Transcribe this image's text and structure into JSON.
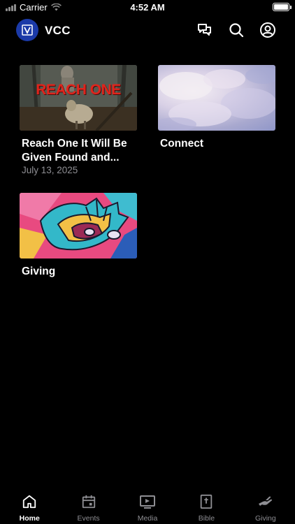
{
  "status_bar": {
    "carrier": "Carrier",
    "time": "4:52 AM",
    "battery_level": 1.0
  },
  "header": {
    "app_title": "VCC",
    "icons": [
      "chat-icon",
      "search-icon",
      "profile-icon"
    ]
  },
  "cards": [
    {
      "title": "Reach One It Will Be Given Found and...",
      "date": "July 13, 2025",
      "thumb_text": "REACH ONE"
    },
    {
      "title": "Connect"
    },
    {
      "title": "Giving"
    }
  ],
  "tabs": [
    {
      "label": "Home",
      "icon": "home-icon",
      "active": true
    },
    {
      "label": "Events",
      "icon": "calendar-icon",
      "active": false
    },
    {
      "label": "Media",
      "icon": "media-icon",
      "active": false
    },
    {
      "label": "Bible",
      "icon": "bible-icon",
      "active": false
    },
    {
      "label": "Giving",
      "icon": "giving-icon",
      "active": false
    }
  ],
  "colors": {
    "background": "#000000",
    "logo_blue": "#1b3aa8",
    "inactive_tab": "#8e8e93"
  }
}
